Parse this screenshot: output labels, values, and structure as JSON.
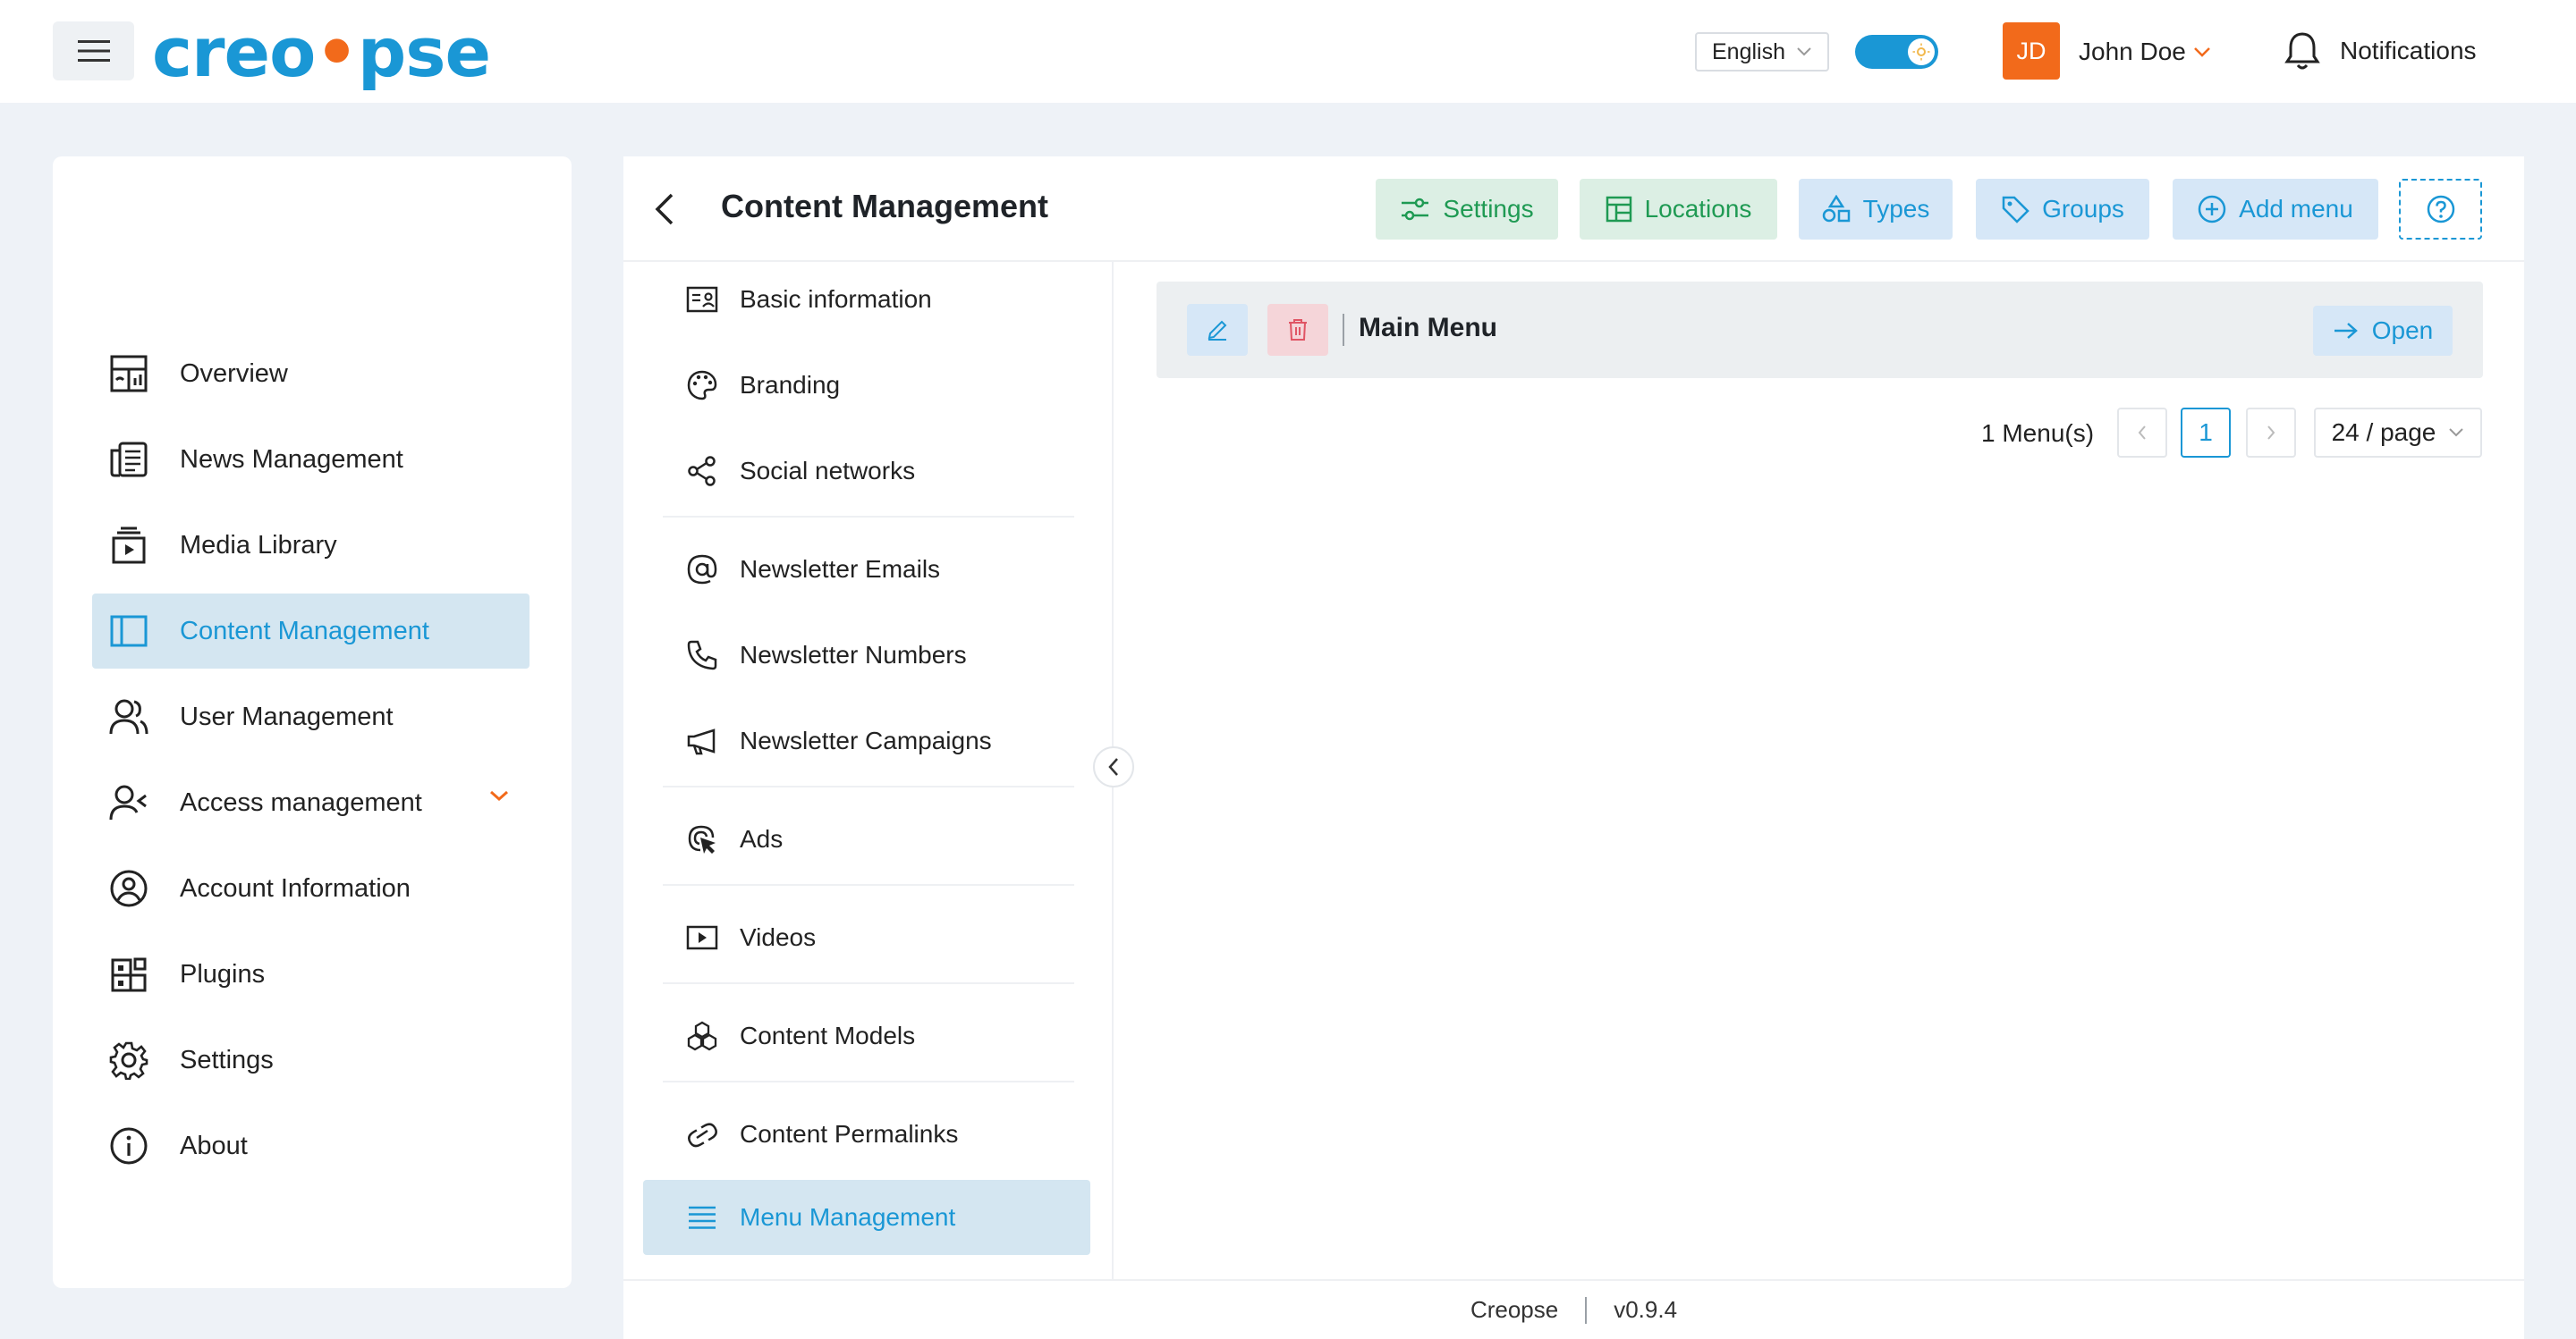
{
  "header": {
    "logo_text_1": "creo",
    "logo_text_2": "pse",
    "language": "English",
    "user_initials": "JD",
    "user_name": "John Doe",
    "notifications_label": "Notifications"
  },
  "sidebar": {
    "items": [
      {
        "label": "Overview",
        "icon": "dashboard-icon"
      },
      {
        "label": "News Management",
        "icon": "newspaper-icon"
      },
      {
        "label": "Media Library",
        "icon": "media-icon"
      },
      {
        "label": "Content Management",
        "icon": "layout-icon"
      },
      {
        "label": "User Management",
        "icon": "users-icon"
      },
      {
        "label": "Access management",
        "icon": "user-access-icon"
      },
      {
        "label": "Account Information",
        "icon": "account-icon"
      },
      {
        "label": "Plugins",
        "icon": "plugins-icon"
      },
      {
        "label": "Settings",
        "icon": "gear-icon"
      },
      {
        "label": "About",
        "icon": "info-icon"
      }
    ]
  },
  "panel": {
    "title": "Content Management",
    "toolbar": {
      "settings": "Settings",
      "locations": "Locations",
      "types": "Types",
      "groups": "Groups",
      "add_menu": "Add menu"
    },
    "subnav": [
      {
        "label": "Basic information"
      },
      {
        "label": "Branding"
      },
      {
        "label": "Social networks"
      },
      {
        "label": "Newsletter Emails"
      },
      {
        "label": "Newsletter Numbers"
      },
      {
        "label": "Newsletter Campaigns"
      },
      {
        "label": "Ads"
      },
      {
        "label": "Videos"
      },
      {
        "label": "Content Models"
      },
      {
        "label": "Content Permalinks"
      },
      {
        "label": "Menu Management"
      }
    ],
    "menu_card": {
      "title": "Main Menu",
      "open_label": "Open"
    },
    "pagination": {
      "count": "1 Menu(s)",
      "current_page": "1",
      "per_page": "24 / page"
    }
  },
  "footer": {
    "app_name": "Creopse",
    "version": "v0.9.4"
  },
  "colors": {
    "brand": "#1a97d5",
    "accent": "#f26a1b",
    "success": "#1f9a53",
    "danger": "#e05565"
  }
}
